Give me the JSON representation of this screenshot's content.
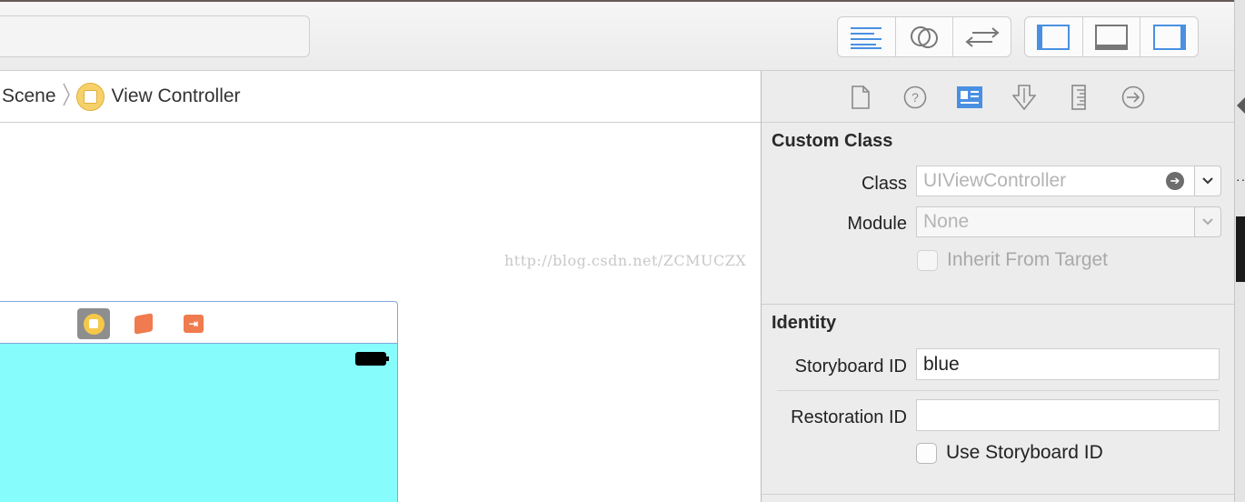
{
  "breadcrumb": {
    "scene_label": "Scene",
    "controller_label": "View Controller"
  },
  "watermark": "http://blog.csdn.net/ZCMUCZX",
  "icons": {
    "editor_modes": [
      "standard-editor-icon",
      "assistant-editor-icon",
      "version-editor-icon"
    ],
    "view_toggles": [
      "navigator-toggle-icon",
      "debug-area-toggle-icon",
      "utilities-toggle-icon"
    ],
    "inspector_tabs": [
      "file-inspector-icon",
      "quick-help-icon",
      "identity-inspector-icon",
      "attributes-inspector-icon",
      "size-inspector-icon",
      "connections-inspector-icon"
    ],
    "scene_dock": [
      "view-controller-icon",
      "first-responder-icon",
      "exit-icon"
    ]
  },
  "colors": {
    "accent": "#4a90e2",
    "view_background": "#86fcfc",
    "scene_orange": "#f07b4e",
    "vc_yellow": "#f6c84a"
  },
  "inspector": {
    "custom_class": {
      "title": "Custom Class",
      "class_label": "Class",
      "class_placeholder": "UIViewController",
      "module_label": "Module",
      "module_placeholder": "None",
      "inherit_label": "Inherit From Target",
      "inherit_checked": false
    },
    "identity": {
      "title": "Identity",
      "storyboard_id_label": "Storyboard ID",
      "storyboard_id_value": "blue",
      "restoration_id_label": "Restoration ID",
      "restoration_id_value": "",
      "use_storyboard_id_label": "Use Storyboard ID",
      "use_storyboard_id_checked": false
    }
  }
}
